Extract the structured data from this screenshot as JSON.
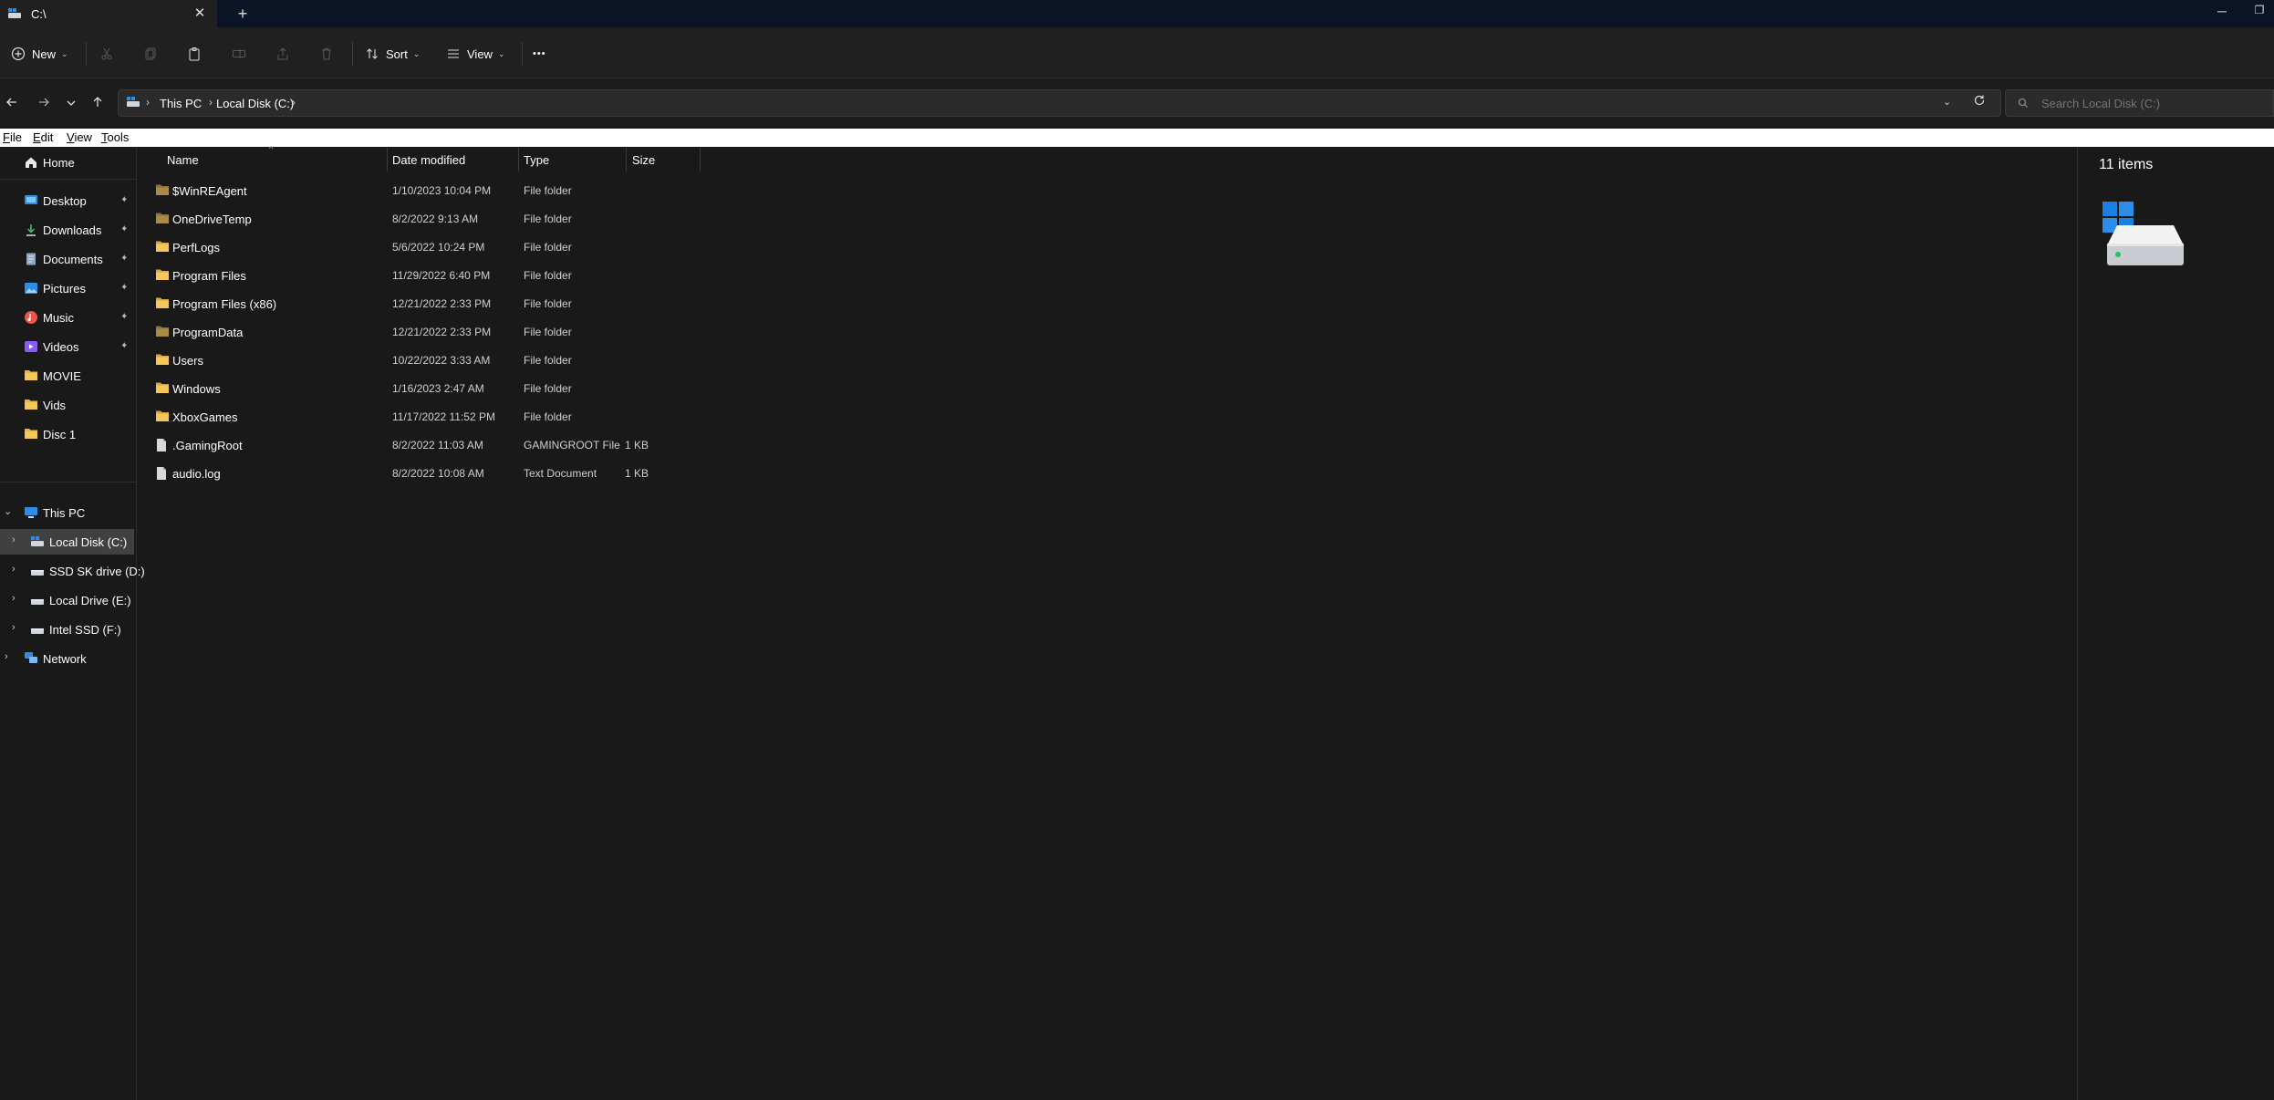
{
  "window": {
    "tab_title": "C:\\",
    "tab_close": "✕",
    "new_tab": "+",
    "minimize": "─",
    "maximize": "❐"
  },
  "toolbar": {
    "new_label": "New",
    "sort_label": "Sort",
    "view_label": "View",
    "more_label": "•••"
  },
  "address": {
    "crumbs": [
      "This PC",
      "Local Disk (C:)"
    ],
    "search_placeholder": "Search Local Disk (C:)"
  },
  "menubar": {
    "items": [
      {
        "mnemonic": "F",
        "rest": "ile"
      },
      {
        "mnemonic": "E",
        "rest": "dit"
      },
      {
        "mnemonic": "V",
        "rest": "iew"
      },
      {
        "mnemonic": "T",
        "rest": "ools"
      }
    ]
  },
  "sidebar": {
    "home": "Home",
    "quick_access": [
      {
        "label": "Desktop",
        "icon": "desktop-icon",
        "pinned": true
      },
      {
        "label": "Downloads",
        "icon": "download-icon",
        "pinned": true
      },
      {
        "label": "Documents",
        "icon": "documents-icon",
        "pinned": true
      },
      {
        "label": "Pictures",
        "icon": "pictures-icon",
        "pinned": true
      },
      {
        "label": "Music",
        "icon": "music-icon",
        "pinned": true
      },
      {
        "label": "Videos",
        "icon": "videos-icon",
        "pinned": true
      },
      {
        "label": "MOVIE",
        "icon": "folder-icon",
        "pinned": false
      },
      {
        "label": "Vids",
        "icon": "folder-icon",
        "pinned": false
      },
      {
        "label": "Disc 1",
        "icon": "folder-icon",
        "pinned": false
      }
    ],
    "this_pc": "This PC",
    "drives": [
      {
        "label": "Local Disk (C:)",
        "selected": true
      },
      {
        "label": "SSD SK drive (D:)",
        "selected": false
      },
      {
        "label": "Local Drive (E:)",
        "selected": false
      },
      {
        "label": "Intel SSD (F:)",
        "selected": false
      }
    ],
    "network": "Network"
  },
  "columns": {
    "name": "Name",
    "date": "Date modified",
    "type": "Type",
    "size": "Size"
  },
  "files": [
    {
      "name": "$WinREAgent",
      "date": "1/10/2023 10:04 PM",
      "type": "File folder",
      "size": "",
      "kind": "folder-dim"
    },
    {
      "name": "OneDriveTemp",
      "date": "8/2/2022 9:13 AM",
      "type": "File folder",
      "size": "",
      "kind": "folder-dim"
    },
    {
      "name": "PerfLogs",
      "date": "5/6/2022 10:24 PM",
      "type": "File folder",
      "size": "",
      "kind": "folder"
    },
    {
      "name": "Program Files",
      "date": "11/29/2022 6:40 PM",
      "type": "File folder",
      "size": "",
      "kind": "folder"
    },
    {
      "name": "Program Files (x86)",
      "date": "12/21/2022 2:33 PM",
      "type": "File folder",
      "size": "",
      "kind": "folder"
    },
    {
      "name": "ProgramData",
      "date": "12/21/2022 2:33 PM",
      "type": "File folder",
      "size": "",
      "kind": "folder-dim"
    },
    {
      "name": "Users",
      "date": "10/22/2022 3:33 AM",
      "type": "File folder",
      "size": "",
      "kind": "folder"
    },
    {
      "name": "Windows",
      "date": "1/16/2023 2:47 AM",
      "type": "File folder",
      "size": "",
      "kind": "folder"
    },
    {
      "name": "XboxGames",
      "date": "11/17/2022 11:52 PM",
      "type": "File folder",
      "size": "",
      "kind": "folder"
    },
    {
      "name": ".GamingRoot",
      "date": "8/2/2022 11:03 AM",
      "type": "GAMINGROOT File",
      "size": "1 KB",
      "kind": "file"
    },
    {
      "name": "audio.log",
      "date": "8/2/2022 10:08 AM",
      "type": "Text Document",
      "size": "1 KB",
      "kind": "file"
    }
  ],
  "details": {
    "item_count": "11 items"
  },
  "colors": {
    "accent": "#0078d4",
    "folder": "#e8b84a",
    "folder_dim": "#a88a45",
    "background": "#191919"
  }
}
